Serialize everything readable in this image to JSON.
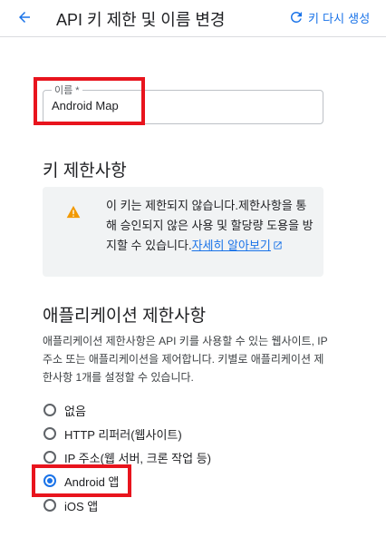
{
  "header": {
    "title": "API 키 제한 및 이름 변경",
    "regenerate_label": "키 다시 생성"
  },
  "name_field": {
    "label": "이름 *",
    "value": "Android Map"
  },
  "key_restrictions": {
    "title": "키 제한사항",
    "notice_text": "이 키는 제한되지 않습니다.제한사항을 통해 승인되지 않은 사용 및 할당량 도용을 방지할 수 있습니다.",
    "notice_link": "자세히 알아보기"
  },
  "app_restrictions": {
    "title": "애플리케이션 제한사항",
    "description": "애플리케이션 제한사항은 API 키를 사용할 수 있는 웹사이트, IP 주소 또는 애플리케이션을 제어합니다. 키별로 애플리케이션 제한사항 1개를 설정할 수 있습니다.",
    "options": [
      {
        "label": "없음",
        "checked": false
      },
      {
        "label": "HTTP 리퍼러(웹사이트)",
        "checked": false
      },
      {
        "label": "IP 주소(웹 서버, 크론 작업 등)",
        "checked": false
      },
      {
        "label": "Android 앱",
        "checked": true
      },
      {
        "label": "iOS 앱",
        "checked": false
      }
    ]
  },
  "colors": {
    "accent": "#1a73e8",
    "highlight": "#e8141d",
    "warning": "#f29900",
    "notice_bg": "#f1f3f4"
  },
  "icons": {
    "back": "arrow-left-icon",
    "regenerate": "refresh-icon",
    "warning": "warning-icon",
    "external": "open-in-new-icon"
  }
}
